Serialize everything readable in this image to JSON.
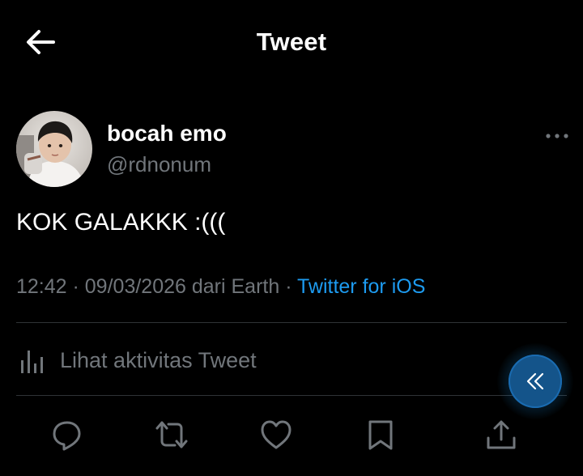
{
  "header": {
    "title": "Tweet",
    "back_icon": "arrow-left-icon"
  },
  "author": {
    "display_name": "bocah emo",
    "handle": "@rdnonum"
  },
  "tweet": {
    "text": "KOK GALAKKK :(((",
    "time": "12:42",
    "separator": " · ",
    "date": "09/03/2026",
    "location": " dari Earth",
    "source": "Twitter for iOS"
  },
  "activity": {
    "label": "Lihat aktivitas Tweet",
    "icon": "bar-chart-icon"
  },
  "actions": {
    "icons": [
      "reply-icon",
      "retweet-icon",
      "like-icon",
      "bookmark-icon",
      "share-icon"
    ]
  },
  "colors": {
    "background": "#000000",
    "primary_text": "#ffffff",
    "secondary_text": "#71767b",
    "accent": "#1d9bf0",
    "divider": "#2f3336",
    "fab": "#14548a"
  }
}
